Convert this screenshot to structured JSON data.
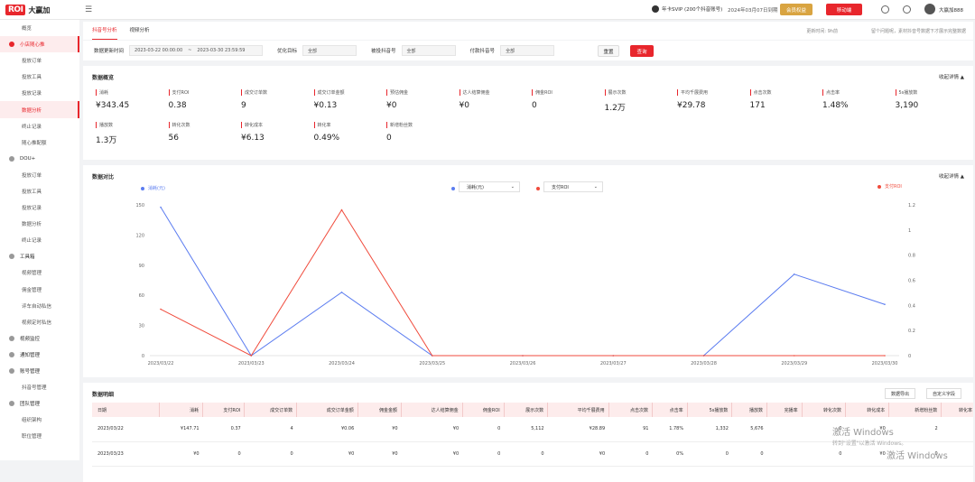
{
  "app": {
    "logo_text": "ROI",
    "name": "大赢加",
    "vip_text": "年卡SVIP (200个抖音账号)",
    "expire_text": "2024年03月07日到期",
    "btn_gold": "会员权益",
    "btn_red": "移动端",
    "username": "大赢加888"
  },
  "sidebar": {
    "items": [
      {
        "label": "概览",
        "type": "item"
      },
      {
        "label": "小店随心推",
        "type": "group",
        "active": true
      },
      {
        "label": "投放订单",
        "type": "item"
      },
      {
        "label": "投放工具",
        "type": "item"
      },
      {
        "label": "投放记录",
        "type": "item"
      },
      {
        "label": "数据分析",
        "type": "item",
        "active": true
      },
      {
        "label": "终止记录",
        "type": "item"
      },
      {
        "label": "随心推配额",
        "type": "item"
      },
      {
        "label": "DOU+",
        "type": "group"
      },
      {
        "label": "投放订单",
        "type": "item"
      },
      {
        "label": "投放工具",
        "type": "item"
      },
      {
        "label": "投放记录",
        "type": "item"
      },
      {
        "label": "数据分析",
        "type": "item"
      },
      {
        "label": "终止记录",
        "type": "item"
      },
      {
        "label": "工具箱",
        "type": "group"
      },
      {
        "label": "视频管理",
        "type": "item"
      },
      {
        "label": "佣金管理",
        "type": "item"
      },
      {
        "label": "评车自动私信",
        "type": "item"
      },
      {
        "label": "视频定时私信",
        "type": "item"
      },
      {
        "label": "视频监控",
        "type": "group"
      },
      {
        "label": "通知管理",
        "type": "group"
      },
      {
        "label": "账号管理",
        "type": "group"
      },
      {
        "label": "抖音号管理",
        "type": "item"
      },
      {
        "label": "团队管理",
        "type": "group"
      },
      {
        "label": "组织架构",
        "type": "item"
      },
      {
        "label": "职位管理",
        "type": "item"
      }
    ]
  },
  "tabs": [
    "抖音号分析",
    "视频分析"
  ],
  "update_time": "更新时间: 9h前",
  "note": "留个问题呢，素材抖音号数据下才展示完整数据",
  "filters": {
    "time_label": "数据更新时间",
    "time_start": "2023-03-22 00:00:00",
    "time_sep": "~",
    "time_end": "2023-03-30 23:59:59",
    "opt_label": "优化目标",
    "opt_value": "全部",
    "account_label": "被投抖音号",
    "account_value": "全部",
    "pay_label": "付款抖音号",
    "pay_value": "全部",
    "reset": "重置",
    "query": "查询"
  },
  "overview": {
    "title": "数据概览",
    "collapse": "收起详情 ▲",
    "metrics": [
      {
        "label": "消耗",
        "value": "¥343.45"
      },
      {
        "label": "支付ROI",
        "value": "0.38"
      },
      {
        "label": "成交订单数",
        "value": "9"
      },
      {
        "label": "成交订单金额",
        "value": "¥0.13"
      },
      {
        "label": "预估佣金",
        "value": "¥0"
      },
      {
        "label": "达人结算佣金",
        "value": "¥0"
      },
      {
        "label": "佣金ROI",
        "value": "0"
      },
      {
        "label": "展示次数",
        "value": "1.2万"
      },
      {
        "label": "平均千展费用",
        "value": "¥29.78"
      },
      {
        "label": "点击次数",
        "value": "171"
      },
      {
        "label": "点击率",
        "value": "1.48%"
      },
      {
        "label": "5s播放数",
        "value": "3,190"
      },
      {
        "label": "播放数",
        "value": "1.3万"
      },
      {
        "label": "转化次数",
        "value": "56"
      },
      {
        "label": "转化成本",
        "value": "¥6.13"
      },
      {
        "label": "转化率",
        "value": "0.49%"
      },
      {
        "label": "新增粉丝数",
        "value": "0"
      }
    ]
  },
  "compare": {
    "title": "数据对比",
    "collapse": "收起详情 ▲",
    "legend_left": "消耗(元)",
    "legend_right": "支付ROI",
    "select1": "消耗(元)",
    "select2": "支付ROI"
  },
  "chart_data": {
    "type": "line",
    "x": [
      "2023/03/22",
      "2023/03/23",
      "2023/03/24",
      "2023/03/25",
      "2023/03/26",
      "2023/03/27",
      "2023/03/28",
      "2023/03/29",
      "2023/03/30"
    ],
    "series": [
      {
        "name": "消耗(元)",
        "axis": "left",
        "color": "#5b7cf0",
        "values": [
          147.71,
          0,
          63,
          0,
          0,
          0,
          0,
          81,
          51
        ]
      },
      {
        "name": "支付ROI",
        "axis": "right",
        "color": "#f04b3c",
        "values": [
          0.37,
          0,
          1.16,
          0,
          0,
          0,
          0,
          0,
          0
        ]
      }
    ],
    "ylim_left": [
      0,
      150
    ],
    "yticks_left": [
      "0",
      "30",
      "60",
      "90",
      "120",
      "150"
    ],
    "ylim_right": [
      0,
      1.2
    ],
    "yticks_right": [
      "0",
      "0.2",
      "0.4",
      "0.6",
      "0.8",
      "1",
      "1.2"
    ],
    "grid": false
  },
  "detail": {
    "title": "数据明细",
    "export": "数据导出",
    "custom": "自定义字段",
    "columns": [
      "日期",
      "消耗",
      "支付ROI",
      "成交订单数",
      "成交订单金额",
      "佣金金额",
      "达人结算佣金",
      "佣金ROI",
      "展示次数",
      "平均千展费用",
      "点击次数",
      "点击率",
      "5s播放数",
      "播放数",
      "完播率",
      "转化次数",
      "转化成本",
      "新增粉丝数",
      "转化率"
    ],
    "rows": [
      [
        "2023/03/22",
        "¥147.71",
        "0.37",
        "4",
        "¥0.06",
        "¥0",
        "¥0",
        "0",
        "5,112",
        "¥28.89",
        "91",
        "1.78%",
        "1,332",
        "5,676",
        "",
        "0",
        "¥0",
        "2",
        ""
      ],
      [
        "2023/03/23",
        "¥0",
        "0",
        "0",
        "¥0",
        "¥0",
        "¥0",
        "0",
        "0",
        "¥0",
        "0",
        "0%",
        "0",
        "0",
        "",
        "0",
        "¥0",
        "0",
        ""
      ]
    ]
  },
  "watermark": {
    "line1": "激活 Windows",
    "line2": "转到\"设置\"以激活 Windows。",
    "line3": "激活 Windows"
  }
}
